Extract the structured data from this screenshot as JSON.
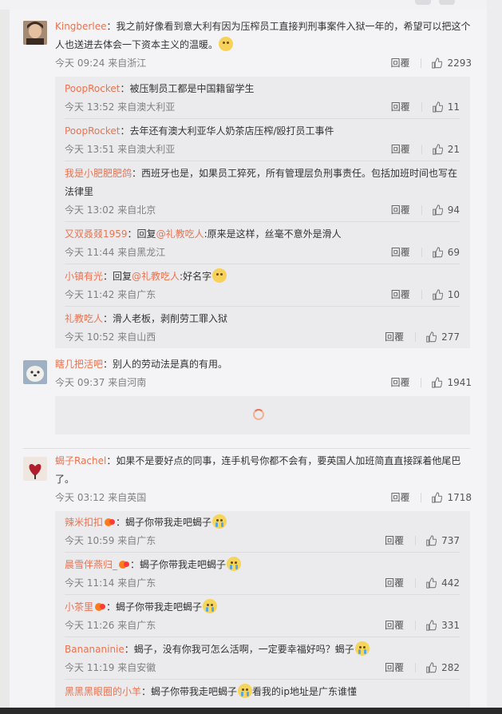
{
  "comments": {
    "c1": {
      "user": "Kingberlee",
      "text": "：我之前好像看到意大利有因为压榨员工直接判刑事案件入狱一年的，希望可以把这个人也送进去体会一下资本主义的温暖。",
      "time": "今天 09:24 来自浙江",
      "reply": "回覆",
      "likes": "2293",
      "replies": [
        {
          "user": "PoopRocket",
          "text": "：被压制员工都是中国籍留学生",
          "time": "今天 13:52 来自澳大利亚",
          "reply": "回覆",
          "likes": "11"
        },
        {
          "user": "PoopRocket",
          "text": "：去年还有澳大利亚华人奶茶店压榨/殴打员工事件",
          "time": "今天 13:51 来自澳大利亚",
          "reply": "回覆",
          "likes": "21"
        },
        {
          "user": "我是小肥肥肥鸽",
          "text": "：西班牙也是，如果员工猝死，所有管理层负刑事责任。包括加班时间也写在法律里",
          "time": "今天 13:02 来自北京",
          "reply": "回覆",
          "likes": "94"
        },
        {
          "user": "又双叒叕1959",
          "pre": "：回复",
          "mention": "@礼教吃人",
          "text": ":原来是这样，丝毫不意外是滑人",
          "time": "今天 11:44 来自黑龙江",
          "reply": "回覆",
          "likes": "69"
        },
        {
          "user": "小镇有光",
          "pre": "：回复",
          "mention": "@礼教吃人",
          "text": ":好名字",
          "time": "今天 11:42 来自广东",
          "reply": "回覆",
          "likes": "10"
        },
        {
          "user": "礼教吃人",
          "text": "：滑人老板，剥削劳工罪入狱",
          "time": "今天 10:52 来自山西",
          "reply": "回覆",
          "likes": "277"
        }
      ]
    },
    "c2": {
      "user": "瞎几把活吧",
      "text": "：别人的劳动法是真的有用。",
      "time": "今天 09:37 来自河南",
      "reply": "回覆",
      "likes": "1941"
    },
    "c3": {
      "user": "蝎子Rachel",
      "text": "：如果不是要好点的同事，连手机号你都不会有，要英国人加班简直直接踩着他尾巴了。",
      "time": "今天 03:12 来自英国",
      "reply": "回覆",
      "likes": "1718",
      "replies": [
        {
          "user": "辣米扣扣",
          "text": "：蝎子你带我走吧蝎子",
          "time": "今天 10:59 来自广东",
          "reply": "回覆",
          "likes": "737"
        },
        {
          "user": "晨雪伴燕归_",
          "text": "：蝎子你带我走吧蝎子",
          "time": "今天 11:14 来自广东",
          "reply": "回覆",
          "likes": "442"
        },
        {
          "user": "小茶里",
          "text": "：蝎子你带我走吧蝎子",
          "time": "今天 11:26 来自广东",
          "reply": "回覆",
          "likes": "331"
        },
        {
          "user": "Banananinie",
          "text": "：蝎子，没有你我可怎么活啊，一定要幸福好吗？蝎子",
          "time": "今天 11:19 来自安徽",
          "reply": "回覆",
          "likes": "282"
        },
        {
          "user": "黑黑黑眼圈的小羊",
          "text": "：蝎子你带我走吧蝎子",
          "tail": "看我的ip地址是广东谁懂"
        }
      ]
    }
  },
  "colors": {
    "accent": "#eb7350",
    "panel": "#f4f4f6",
    "subpanel": "#ebebed"
  },
  "icons": {
    "like": "thumbs-up-icon",
    "loading": "loading-spinner-icon"
  }
}
